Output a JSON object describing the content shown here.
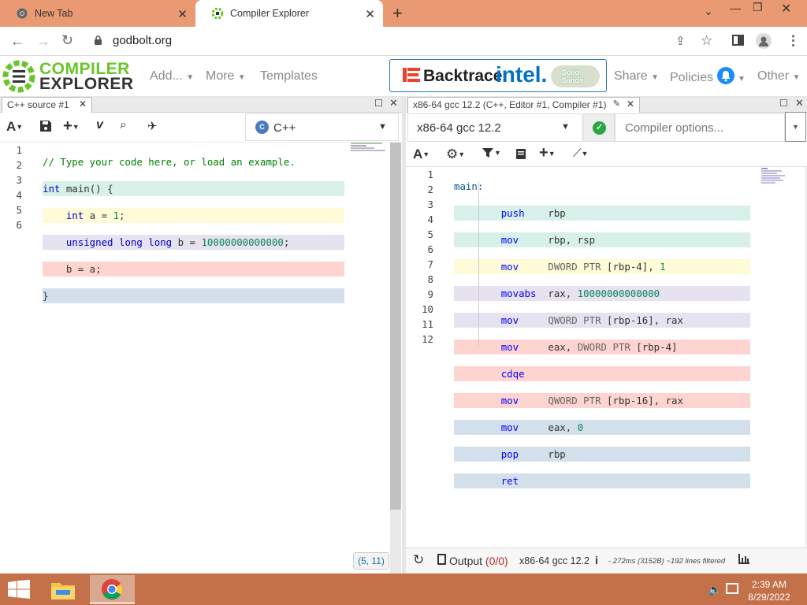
{
  "browser": {
    "tabs": [
      {
        "title": "New Tab"
      },
      {
        "title": "Compiler Explorer"
      }
    ],
    "url": "godbolt.org"
  },
  "header": {
    "logo_line1": "COMPILER",
    "logo_line2": "EXPLORER",
    "add": "Add...",
    "more": "More",
    "templates": "Templates",
    "sponsor1": "Backtrace",
    "sponsor2": "intel.",
    "sponsor3": "Solid Sands",
    "share": "Share",
    "policies": "Policies",
    "other": "Other"
  },
  "editor": {
    "tab_title": "C++ source #1",
    "language": "C++",
    "cursor_pos": "(5, 11)",
    "line_numbers": [
      "1",
      "2",
      "3",
      "4",
      "5",
      "6"
    ]
  },
  "compiler": {
    "tab_title": "x86-64 gcc 12.2 (C++, Editor #1, Compiler #1)",
    "name": "x86-64 gcc 12.2",
    "options_placeholder": "Compiler options...",
    "line_numbers": [
      "1",
      "2",
      "3",
      "4",
      "5",
      "6",
      "7",
      "8",
      "9",
      "10",
      "11",
      "12"
    ],
    "output_label": "Output",
    "output_count": "(0/0)",
    "footer_compiler": "x86-64 gcc 12.2",
    "stats": "- 272ms (3152B) ~192 lines filtered"
  },
  "taskbar": {
    "time": "2:39 AM",
    "date": "8/29/2022"
  },
  "colors": {
    "accent": "#67c52a",
    "link_blue": "#2a78b9",
    "taskbar": "#c47049",
    "tabstrip": "#ea9a72"
  }
}
